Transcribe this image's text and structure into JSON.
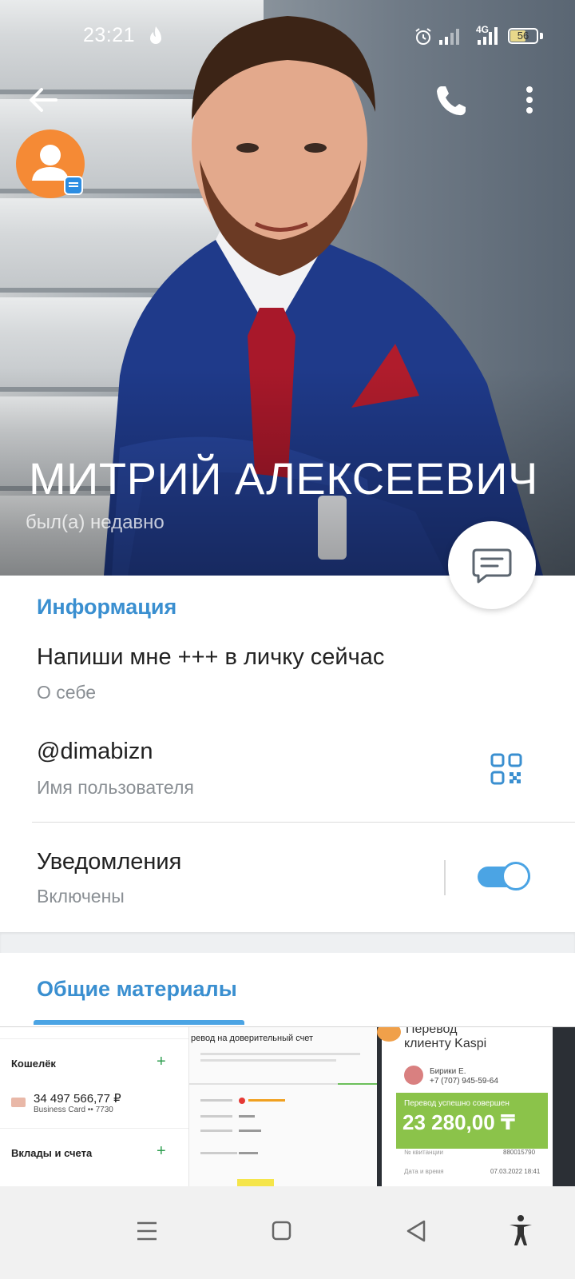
{
  "status_bar": {
    "time": "23:21",
    "network": "4G",
    "battery": "56",
    "battery_level": 0.56
  },
  "header": {
    "name": "МИТРИЙ АЛЕКСЕЕВИЧ",
    "last_seen": "был(а) недавно"
  },
  "icons": {
    "back": "arrow-left-icon",
    "call": "phone-icon",
    "more": "more-vertical-icon",
    "message": "chat-bubble-icon",
    "qr": "qr-code-icon"
  },
  "info": {
    "section_title": "Информация",
    "bio": "Напиши мне +++ в личку сейчас",
    "bio_caption": "О себе",
    "username": "@dimabizn",
    "username_caption": "Имя пользователя",
    "notifications": "Уведомления",
    "notifications_state": "Включены",
    "notifications_on": true
  },
  "media": {
    "section_title": "Общие материалы",
    "thumb1": {
      "wallet": "Кошелёк",
      "amount": "34 497 566,77 ₽",
      "card": "Business Card •• 7730",
      "deposits": "Вклады и счета"
    },
    "thumb2": {
      "title": "ревод на доверительный счет"
    },
    "thumb3": {
      "title_1": "Перевод",
      "title_2": "клиенту Kaspi",
      "recipient": "Бирики Е.",
      "phone": "+7 (707) 945-59-64",
      "success": "Перевод успешно совершен",
      "amount": "23 280,00 ₸",
      "receipt_label": "№ квитанции",
      "receipt_value": "880015790",
      "date_label": "Дата и время",
      "date_value": "07.03.2022 18:41"
    }
  },
  "colors": {
    "accent": "#3a8fd0",
    "toggle": "#4ba4e4",
    "avatar": "#f58a35",
    "kaspi_green": "#8bc34a"
  }
}
